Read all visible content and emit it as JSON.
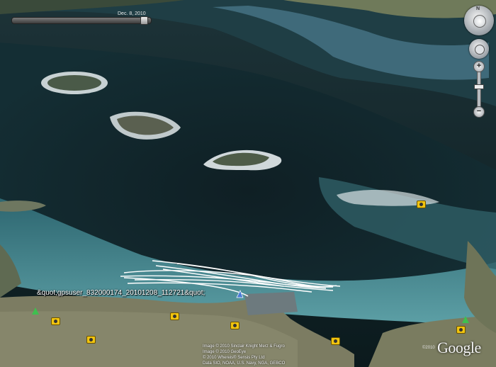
{
  "timeline": {
    "date_label": "Dec. 8, 2010"
  },
  "navigation": {
    "compass_north": "N",
    "zoom_in": "+",
    "zoom_out": "−"
  },
  "track": {
    "label": "&quot;gpsuser_832000174_20101208_112721&quot;"
  },
  "credits": {
    "lines": [
      "Image © 2010 Sinclair Knight Merz & Fugro",
      "Image © 2010 GeoEye",
      "© 2010 Whereis® Sensis Pty Ltd",
      "Data SIO, NOAA, U.S. Navy, NGA, GEBCO"
    ],
    "year": "©2010"
  },
  "logo": {
    "text": "Google"
  },
  "colors": {
    "deep_water": "#0d2027",
    "shallow_water": "#3e7f8a",
    "land": "#8a8a70",
    "track": "#ffffff",
    "placemark": "#f1c40f"
  },
  "icons": [
    "camera-placemark-icon",
    "tree-placemark-icon",
    "compass-icon",
    "look-joystick-icon",
    "zoom-slider"
  ]
}
